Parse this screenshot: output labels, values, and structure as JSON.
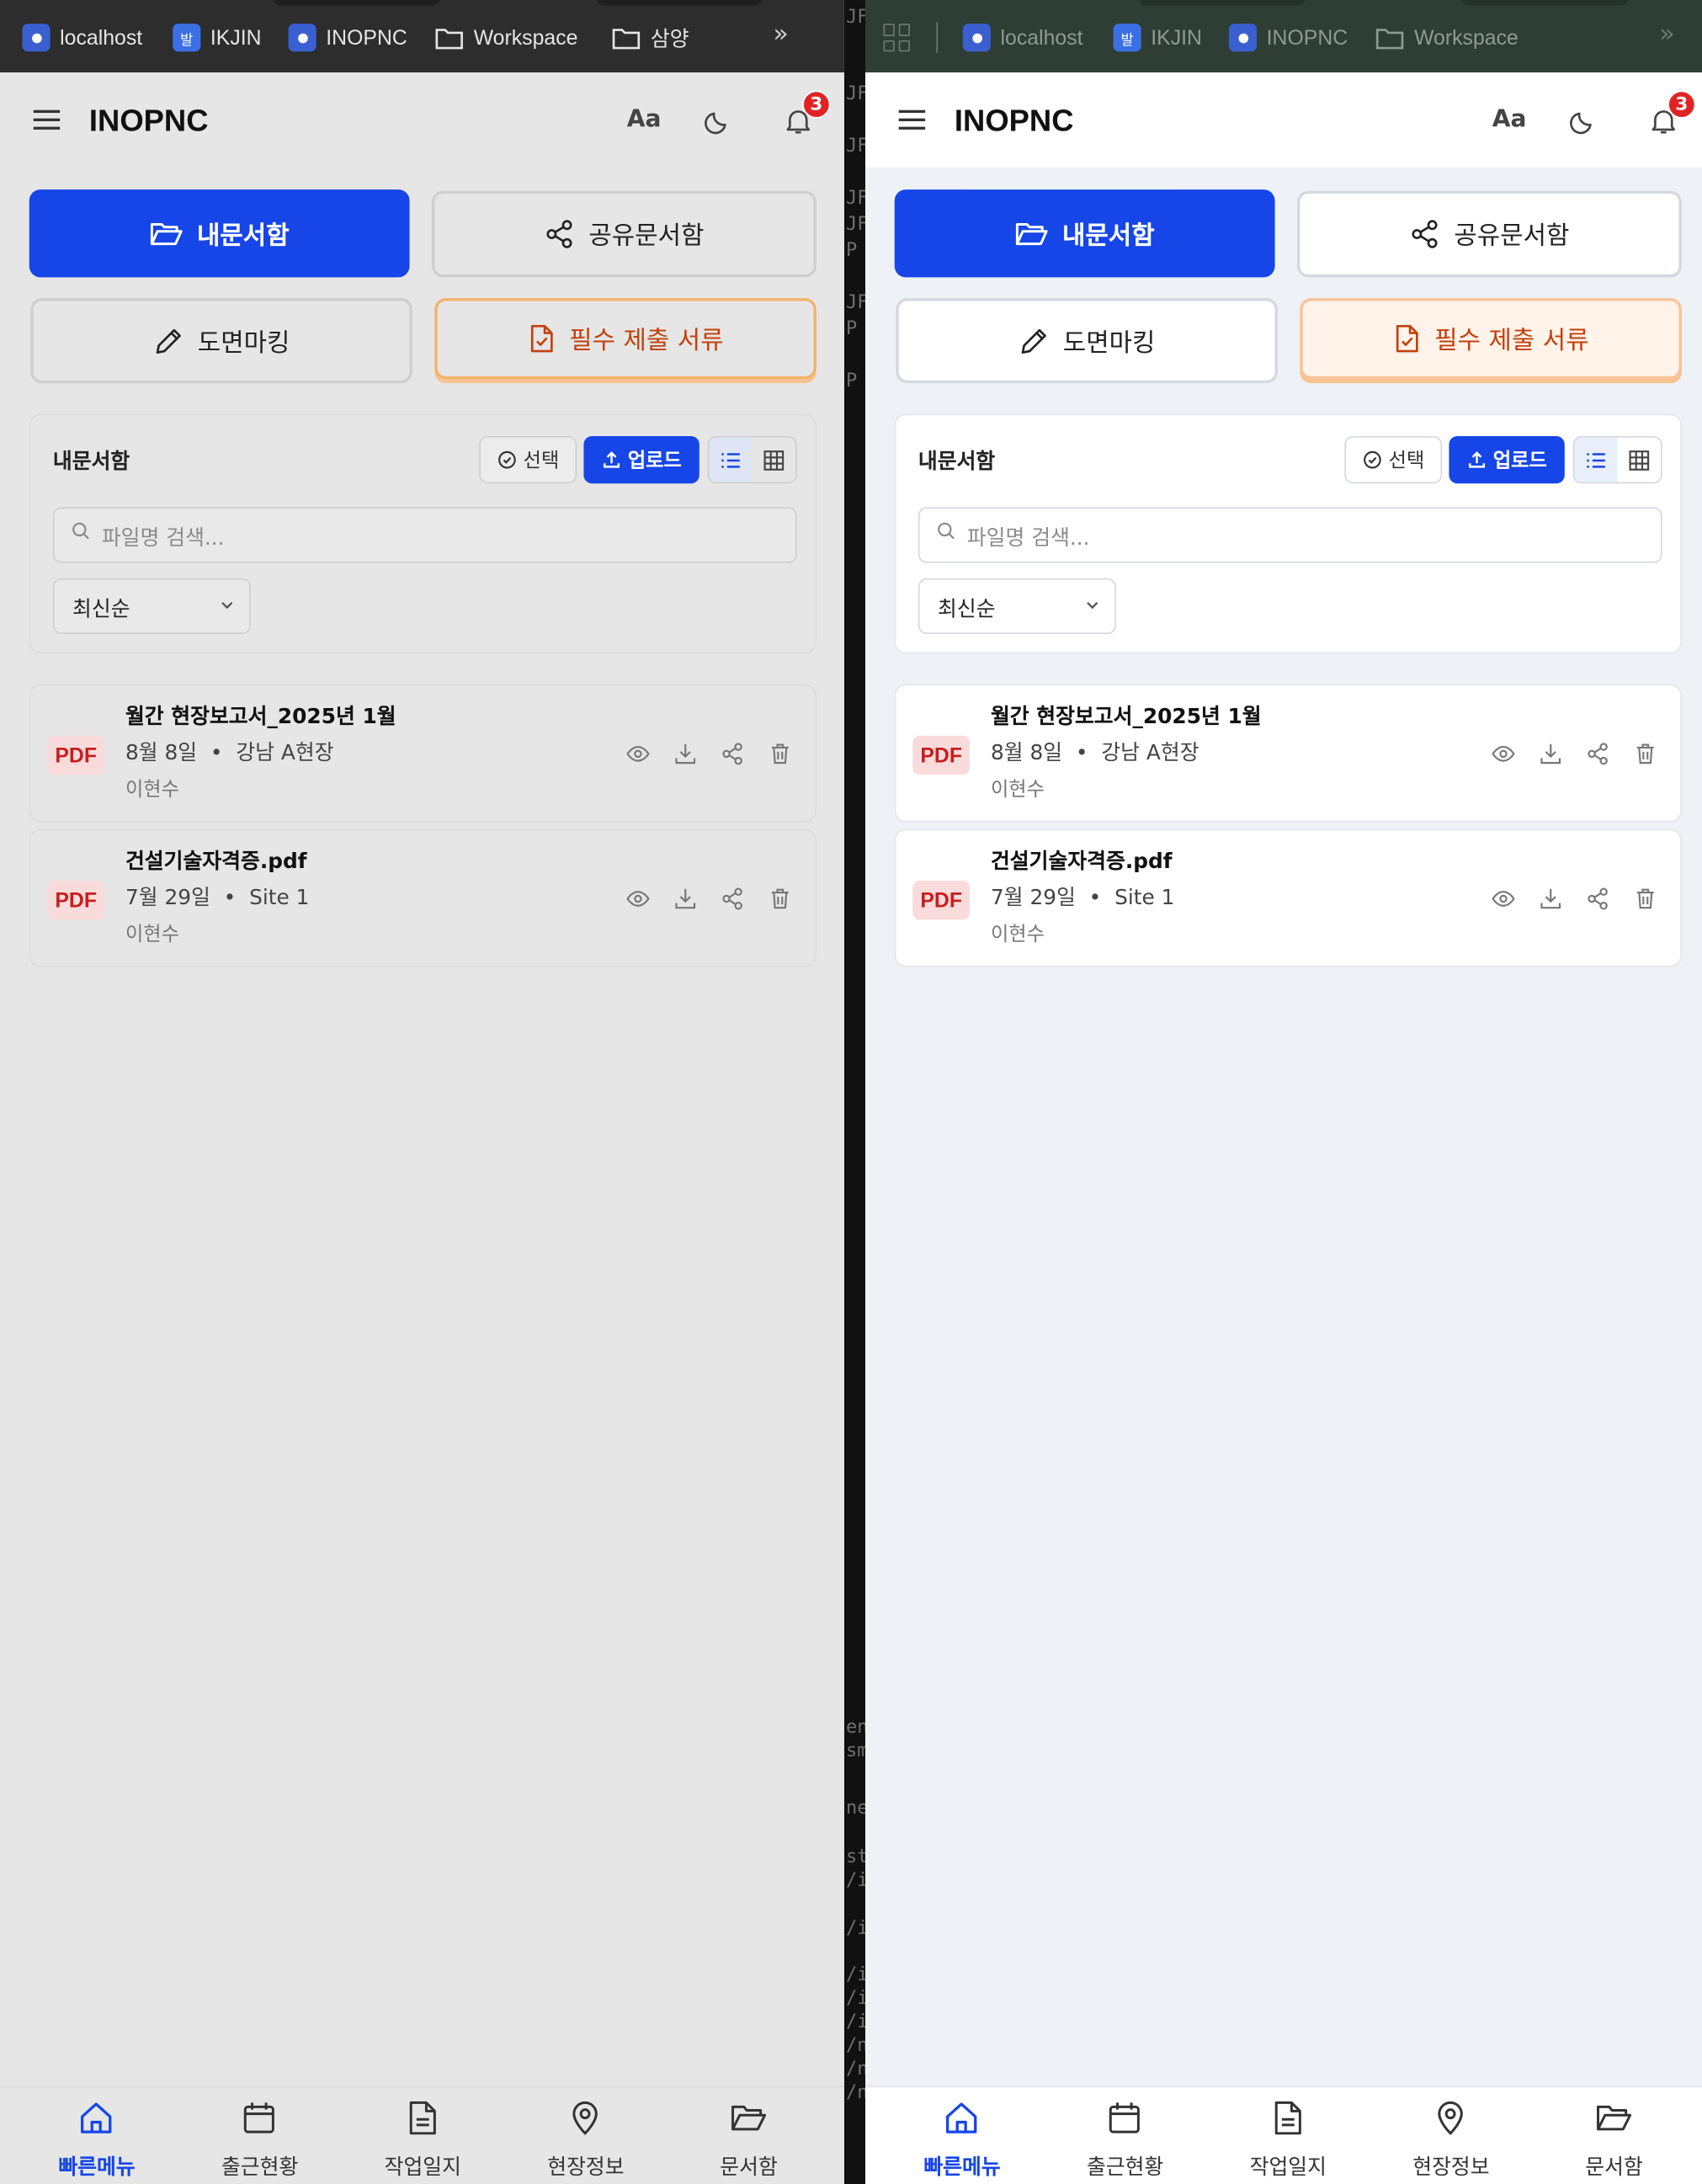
{
  "bookmarks": {
    "items": [
      {
        "label": "localhost",
        "icon": "globe-favicon"
      },
      {
        "label": "IKJIN",
        "icon": "발",
        "favicon_text": "발"
      },
      {
        "label": "INOPNC",
        "icon": "globe-favicon"
      },
      {
        "label": "Workspace",
        "icon": "folder-icon"
      },
      {
        "label": "삼양",
        "icon": "folder-icon"
      }
    ],
    "more": "»"
  },
  "header": {
    "brand": "INOPNC",
    "font_toggle": "Aa",
    "notification_count": "3"
  },
  "tabs": {
    "my_docs": "내문서함",
    "shared_docs": "공유문서함",
    "drawing_marking": "도면마킹",
    "required_docs": "필수 제출 서류"
  },
  "card": {
    "title": "내문서함",
    "select_label": "선택",
    "upload_label": "업로드",
    "search_placeholder": "파일명 검색...",
    "sort_value": "최신순"
  },
  "documents": [
    {
      "badge": "PDF",
      "title": "월간 현장보고서_2025년 1월",
      "date": "8월 8일",
      "site": "강남 A현장",
      "author": "이현수"
    },
    {
      "badge": "PDF",
      "title": "건설기술자격증.pdf",
      "date": "7월 29일",
      "site": "Site 1",
      "author": "이현수"
    }
  ],
  "bottom_nav": [
    {
      "label": "빠른메뉴",
      "active": true
    },
    {
      "label": "출근현황",
      "active": false
    },
    {
      "label": "작업일지",
      "active": false
    },
    {
      "label": "현장정보",
      "active": false
    },
    {
      "label": "문서함",
      "active": false
    }
  ],
  "colors": {
    "primary": "#1646e8",
    "warning": "#c2410c",
    "badge": "#e02424"
  }
}
